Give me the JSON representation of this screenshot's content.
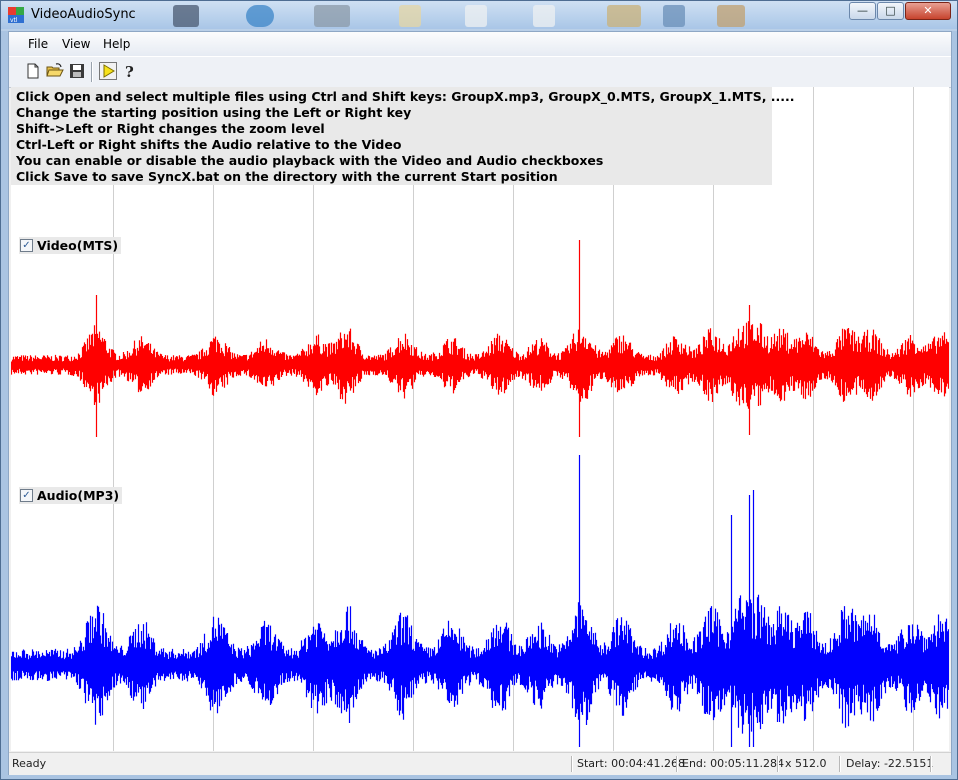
{
  "window": {
    "title": "VideoAudioSync"
  },
  "menu": [
    "File",
    "View",
    "Help"
  ],
  "toolbar": {
    "icons": [
      "new-file-icon",
      "open-folder-icon",
      "save-icon",
      "play-icon",
      "help-icon"
    ]
  },
  "help_lines": [
    "Click Open and select multiple files using Ctrl and Shift keys: GroupX.mp3, GroupX_0.MTS, GroupX_1.MTS, .....",
    "Change the starting position using the Left or Right key",
    "Shift->Left or Right changes the zoom level",
    "Ctrl-Left or Right shifts the Audio relative to the Video",
    "You can enable or disable the audio playback with the Video and Audio checkboxes",
    "Click Save to save SyncX.bat on the directory with the current Start position"
  ],
  "tracks": {
    "video": {
      "label": "Video(MTS)",
      "checked": true,
      "color": "#ff0000"
    },
    "audio": {
      "label": "Audio(MP3)",
      "checked": true,
      "color": "#0000ff"
    }
  },
  "status": {
    "ready": "Ready",
    "start": "Start: 00:04:41.268",
    "end": "End: 00:05:11.284",
    "zoom": "x 512.0",
    "delay": "Delay: -22.5151"
  }
}
